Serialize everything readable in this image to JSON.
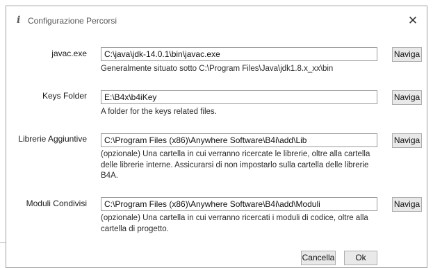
{
  "dialog": {
    "title": "Configurazione Percorsi",
    "title_icon": "i",
    "close_glyph": "✕"
  },
  "rows": [
    {
      "label": "javac.exe",
      "value": "C:\\java\\jdk-14.0.1\\bin\\javac.exe",
      "browse_label": "Naviga",
      "help": "Generalmente situato sotto C:\\Program Files\\Java\\jdk1.8.x_xx\\bin"
    },
    {
      "label": "Keys Folder",
      "value": "E:\\B4x\\b4iKey",
      "browse_label": "Naviga",
      "help": "A folder for the keys related files."
    },
    {
      "label": "Librerie Aggiuntive",
      "value": "C:\\Program Files (x86)\\Anywhere Software\\B4i\\add\\Lib",
      "browse_label": "Naviga",
      "help": "(opzionale) Una cartella in cui verranno ricercate le librerie, oltre alla cartella delle librerie interne. Assicurarsi di non impostarlo sulla cartella delle librerie B4A."
    },
    {
      "label": "Moduli Condivisi",
      "value": "C:\\Program Files (x86)\\Anywhere Software\\B4i\\add\\Moduli",
      "browse_label": "Naviga",
      "help": "(opzionale) Una cartella in cui verranno ricercati i moduli di codice, oltre alla cartella di progetto."
    }
  ],
  "footer": {
    "cancel_label": "Cancella",
    "ok_label": "Ok"
  }
}
